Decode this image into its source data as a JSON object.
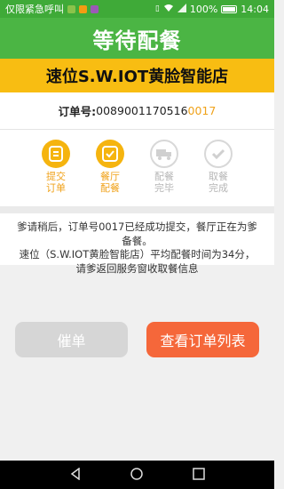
{
  "status_bar": {
    "carrier_text": "仅限紧急呼叫",
    "battery_percent": "100%",
    "time": "14:04",
    "icons": [
      "app-green-icon",
      "app-orange-icon",
      "app-purple-icon",
      "vibrate-icon",
      "wifi-icon",
      "battery-icon"
    ]
  },
  "header": {
    "title": "等待配餐"
  },
  "store": {
    "name": "速位S.W.IOT黄脸智能店"
  },
  "order": {
    "label": "订单号:",
    "number_main": "0089001170516",
    "number_highlight": "0017"
  },
  "steps": [
    {
      "line1": "提交",
      "line2": "订单",
      "state": "active",
      "icon": "list-icon"
    },
    {
      "line1": "餐厅",
      "line2": "配餐",
      "state": "active",
      "icon": "check-icon"
    },
    {
      "line1": "配餐",
      "line2": "完毕",
      "state": "inactive",
      "icon": "truck-icon"
    },
    {
      "line1": "取餐",
      "line2": "完成",
      "state": "inactive",
      "icon": "check-icon"
    }
  ],
  "message": {
    "line1": "爹请稍后，订单号0017已经成功提交，餐厅正在为爹",
    "line2": "备餐。",
    "line3": "速位（S.W.IOT黄脸智能店）平均配餐时间为34分，",
    "line4": "请爹返回服务窗收取餐信息"
  },
  "buttons": {
    "urge": "催单",
    "view_list": "查看订单列表"
  },
  "colors": {
    "header_green": "#4bb544",
    "store_yellow": "#f8bd12",
    "step_active": "#f5b40f",
    "accent_orange": "#f5673a"
  }
}
